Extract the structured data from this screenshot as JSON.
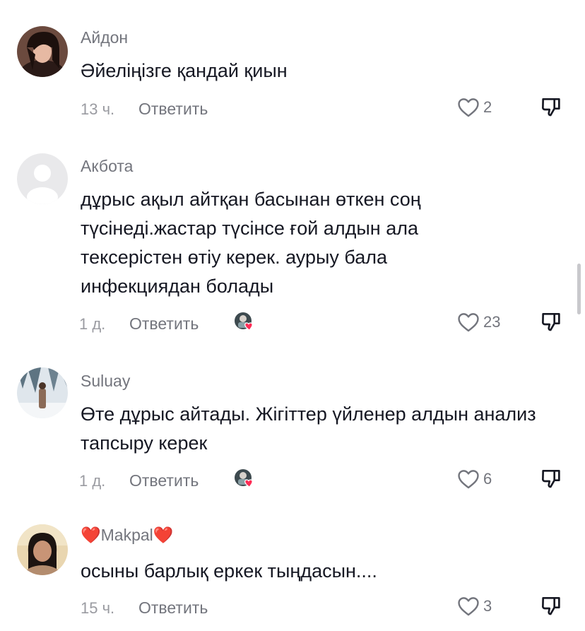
{
  "comments": [
    {
      "username": "Айдон",
      "text": "Әйеліңізге қандай қиын",
      "time": "13 ч.",
      "reply_label": "Ответить",
      "likes": "2",
      "liked_by_author": false
    },
    {
      "username": "Акбота",
      "text": "дұрыс ақыл айтқан басынан өткен соң түсінеді.жастар түсінсе ғой алдын ала тексерістен өтіу керек. аурыу бала инфекциядан болады",
      "time": "1 д.",
      "reply_label": "Ответить",
      "likes": "23",
      "liked_by_author": true
    },
    {
      "username": "Suluay",
      "text": "Өте дұрыс айтады. Жігіттер үйленер алдын анализ тапсыру керек",
      "time": "1 д.",
      "reply_label": "Ответить",
      "likes": "6",
      "liked_by_author": true
    },
    {
      "username": "❤️Makpal❤️",
      "text": "осыны барлық еркек тыңдасын....",
      "time": "15 ч.",
      "reply_label": "Ответить",
      "likes": "3",
      "liked_by_author": false
    }
  ],
  "colors": {
    "text": "#161823",
    "secondary": "#73757d",
    "like_badge": "#fe2c55"
  }
}
